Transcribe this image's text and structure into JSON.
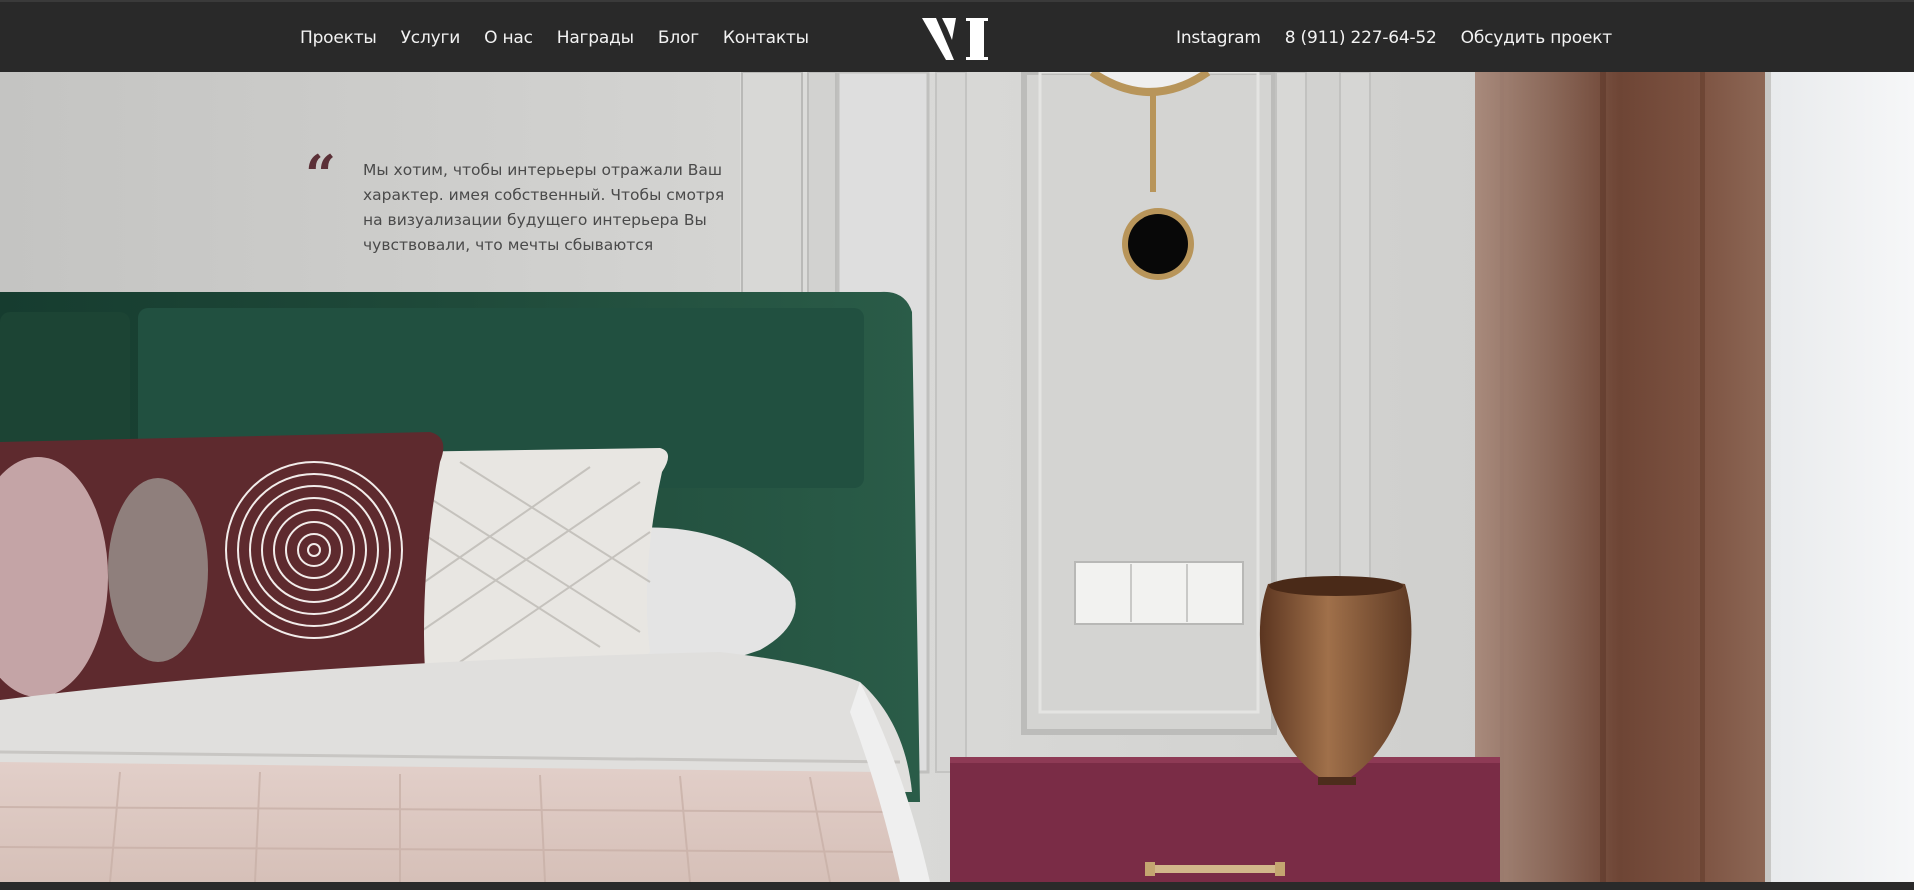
{
  "header": {
    "nav_left": [
      {
        "label": "Проекты"
      },
      {
        "label": "Услуги"
      },
      {
        "label": "О нас"
      },
      {
        "label": "Награды"
      },
      {
        "label": "Блог"
      },
      {
        "label": "Контакты"
      }
    ],
    "nav_right": {
      "instagram": "Instagram",
      "phone": "8 (911) 227-64-52",
      "cta": "Обсудить проект"
    }
  },
  "hero": {
    "quote": "Мы хотим, чтобы интерьеры отражали Ваш характер. имея собственный. Чтобы смотря на визуализации будущего интерьера Вы чувствовали, что мечты сбываются"
  },
  "colors": {
    "header_bg": "#292929",
    "header_text": "#f2f2f2",
    "quote_mark": "#5b3037",
    "headboard_green": "#1f4a3a",
    "nightstand": "#7a2c46",
    "curtain": "#8a6252"
  },
  "icons": {
    "logo": "vi-logo",
    "quote": "quotation-mark-icon"
  }
}
